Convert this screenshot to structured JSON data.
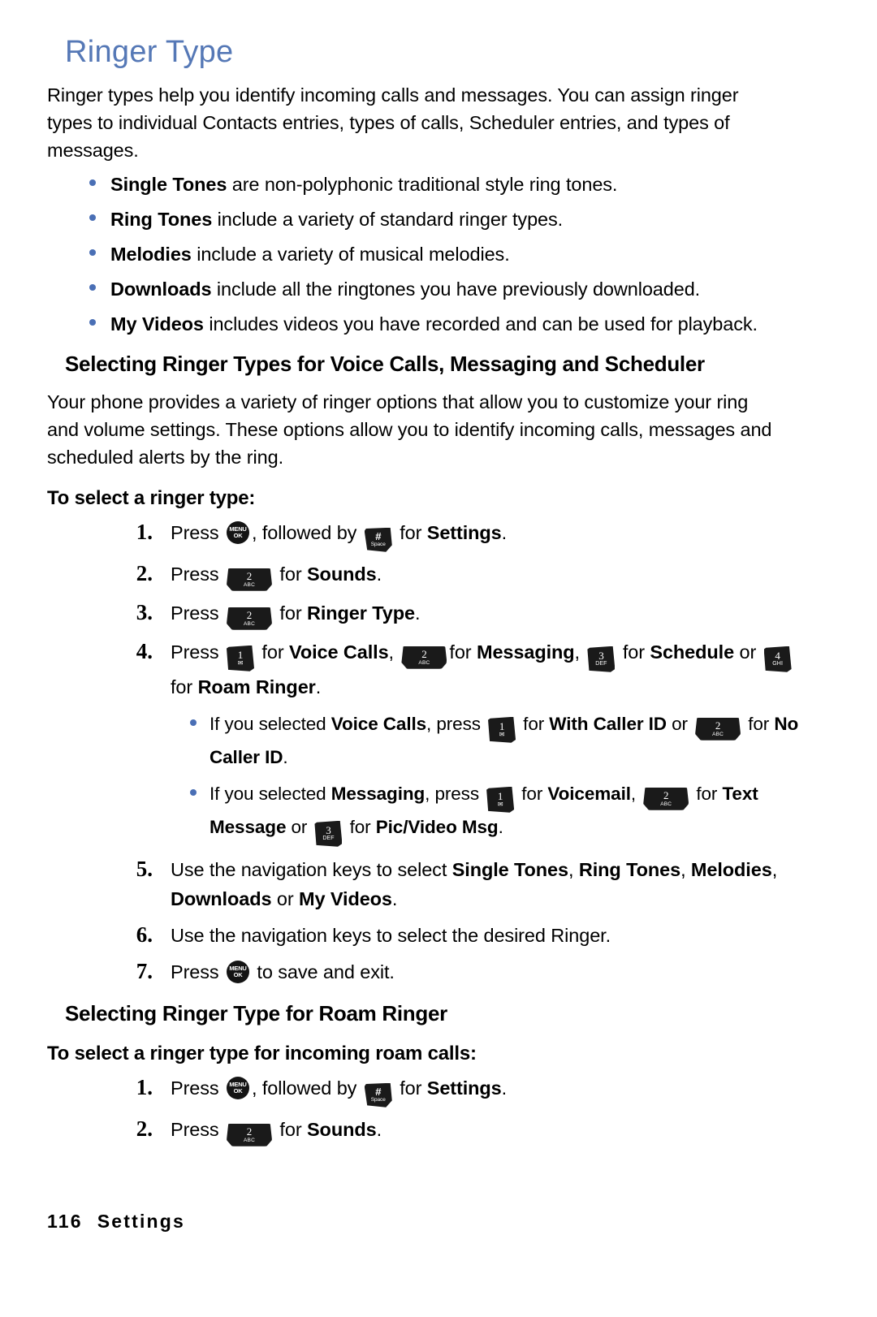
{
  "page": {
    "title": "Ringer Type",
    "title_color": "#5578b6",
    "bullet_color": "#4a6fb5",
    "footer": {
      "page_number": "116",
      "section": "Settings"
    }
  },
  "intro": {
    "paragraph": "Ringer types help you identify incoming calls and messages. You can assign ringer types to individual Contacts entries, types of calls, Scheduler entries, and types of messages."
  },
  "ringer_types": [
    {
      "term": "Single Tones",
      "description": " are non-polyphonic traditional style ring tones."
    },
    {
      "term": "Ring Tones",
      "description": " include a variety of standard ringer types."
    },
    {
      "term": "Melodies",
      "description": " include a variety of musical melodies."
    },
    {
      "term": "Downloads",
      "description": " include all the ringtones you have previously downloaded."
    },
    {
      "term": "My Videos",
      "description": " includes videos you have recorded and can be used for playback."
    }
  ],
  "section_one": {
    "heading": "Selecting Ringer Types for Voice Calls, Messaging and Scheduler",
    "paragraph": "Your phone provides a variety of ringer options that allow you to customize your ring and volume settings. These options allow you to identify incoming calls, messages and scheduled alerts by the ring.",
    "subheading": "To select a ringer type:",
    "steps": {
      "s1": {
        "num": "1.",
        "t1": "Press ",
        "t2": ", followed by ",
        "t3": " for ",
        "bold": "Settings",
        "t4": "."
      },
      "s2": {
        "num": "2.",
        "t1": "Press ",
        "t2": " for ",
        "bold": "Sounds",
        "t3": "."
      },
      "s3": {
        "num": "3.",
        "t1": "Press ",
        "t2": " for ",
        "bold": "Ringer Type",
        "t3": "."
      },
      "s4": {
        "num": "4.",
        "t1": "Press ",
        "t2": " for ",
        "b1": "Voice Calls",
        "t3": ", ",
        "t4": "for ",
        "b2": "Messaging",
        "t5": ", ",
        "t6": " for ",
        "b3": "Schedule",
        "t7": " or ",
        "t8": " for ",
        "b4": "Roam Ringer",
        "t9": "."
      },
      "s4_sub1": {
        "t1": "If you selected ",
        "b1": "Voice Calls",
        "t2": ", press ",
        "t3": " for ",
        "b2": "With Caller ID",
        "t4": " or ",
        "t5": " for ",
        "b3": "No Caller ID",
        "t6": "."
      },
      "s4_sub2": {
        "t1": "If you selected ",
        "b1": "Messaging",
        "t2": ", press ",
        "t3": " for ",
        "b2": "Voicemail",
        "t4": ", ",
        "t5": " for ",
        "b3": "Text Message",
        "t6": " or ",
        "t7": " for ",
        "b4": "Pic/Video Msg",
        "t8": "."
      },
      "s5": {
        "num": "5.",
        "t1": "Use the navigation keys to select ",
        "b1": "Single Tones",
        "t2": ", ",
        "b2": "Ring Tones",
        "t3": ", ",
        "b3": "Melodies",
        "t4": ", ",
        "b4": "Downloads",
        "t5": " or ",
        "b5": "My Videos",
        "t6": "."
      },
      "s6": {
        "num": "6.",
        "t1": "Use the navigation keys to select the desired Ringer."
      },
      "s7": {
        "num": "7.",
        "t1": "Press ",
        "t2": " to save and exit."
      }
    }
  },
  "section_two": {
    "heading": "Selecting Ringer Type for Roam Ringer",
    "subheading": "To select a ringer type for incoming roam calls:",
    "steps": {
      "s1": {
        "num": "1.",
        "t1": "Press ",
        "t2": ", followed by ",
        "t3": " for ",
        "bold": "Settings",
        "t4": "."
      },
      "s2": {
        "num": "2.",
        "t1": "Press ",
        "t2": " for ",
        "bold": "Sounds",
        "t3": "."
      }
    }
  },
  "keys": {
    "menu_ok": {
      "line1": "MENU",
      "line2": "OK"
    },
    "hash": {
      "line1": "#",
      "line2": "Space"
    },
    "k1": {
      "line1": "1",
      "line2": "✉"
    },
    "k2": {
      "line1": "2",
      "line2": "ABC"
    },
    "k3": {
      "line1": "3",
      "line2": "DEF"
    },
    "k4": {
      "line1": "4",
      "line2": "GHI"
    }
  }
}
